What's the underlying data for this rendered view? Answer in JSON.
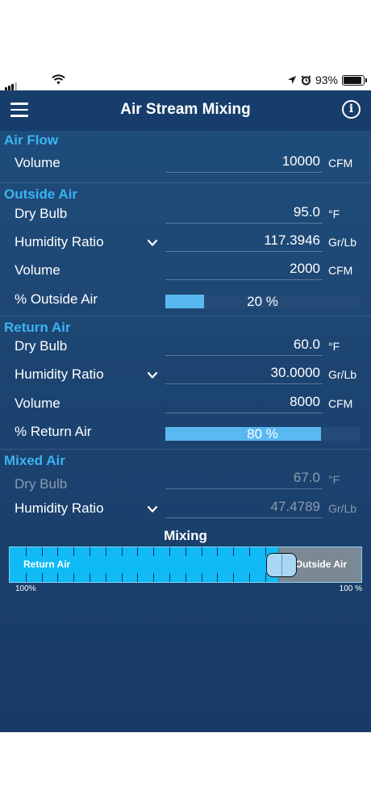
{
  "status": {
    "battery": "93%"
  },
  "nav": {
    "title": "Air Stream Mixing"
  },
  "air_flow": {
    "title": "Air Flow",
    "volume": {
      "label": "Volume",
      "value": "10000",
      "unit": "CFM"
    }
  },
  "outside_air": {
    "title": "Outside Air",
    "dry_bulb": {
      "label": "Dry Bulb",
      "value": "95.0",
      "unit": "°F"
    },
    "humidity": {
      "label": "Humidity Ratio",
      "value": "117.3946",
      "unit": "Gr/Lb"
    },
    "volume": {
      "label": "Volume",
      "value": "2000",
      "unit": "CFM"
    },
    "percent": {
      "label": "% Outside Air",
      "text": "20 %",
      "fraction": 0.2
    }
  },
  "return_air": {
    "title": "Return Air",
    "dry_bulb": {
      "label": "Dry Bulb",
      "value": "60.0",
      "unit": "°F"
    },
    "humidity": {
      "label": "Humidity Ratio",
      "value": "30.0000",
      "unit": "Gr/Lb"
    },
    "volume": {
      "label": "Volume",
      "value": "8000",
      "unit": "CFM"
    },
    "percent": {
      "label": "% Return Air",
      "text": "80 %",
      "fraction": 0.8
    }
  },
  "mixed_air": {
    "title": "Mixed Air",
    "dry_bulb": {
      "label": "Dry Bulb",
      "value": "67.0",
      "unit": "°F"
    },
    "humidity": {
      "label": "Humidity Ratio",
      "value": "47.4789",
      "unit": "Gr/Lb"
    }
  },
  "mixing": {
    "title": "Mixing",
    "return_label": "Return Air",
    "outside_label": "Outside Air",
    "left_pct": "100%",
    "right_pct": "100 %",
    "outside_fraction": 0.2
  },
  "colors": {
    "accent": "#3ab4f2",
    "return_fill": "#0fbaf5",
    "outside_fill": "#7b8994",
    "background": "#1d4572"
  },
  "icons": [
    "menu-icon",
    "info-icon",
    "chevron-down-icon",
    "wifi-icon",
    "location-icon",
    "alarm-icon",
    "battery-icon"
  ]
}
